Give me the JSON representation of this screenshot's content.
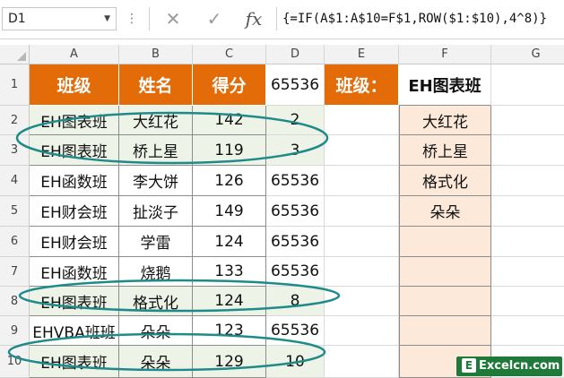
{
  "name_box": "D1",
  "formula": "{=IF(A$1:A$10=F$1,ROW($1:$10),4^8)}",
  "icons": {
    "cancel": "✕",
    "enter": "✓",
    "fx": "fx"
  },
  "columns": [
    "A",
    "B",
    "C",
    "D",
    "E",
    "F",
    "G"
  ],
  "rows": [
    "1",
    "2",
    "3",
    "4",
    "5",
    "6",
    "7",
    "8",
    "9",
    "10"
  ],
  "headers": {
    "class": "班级",
    "name": "姓名",
    "score": "得分"
  },
  "d1_value": "65536",
  "e1_label": "班级：",
  "f1_value": "EH图表班",
  "table": [
    {
      "class": "EH图表班",
      "name": "大红花",
      "score": "142",
      "d": "2"
    },
    {
      "class": "EH图表班",
      "name": "桥上星",
      "score": "119",
      "d": "3"
    },
    {
      "class": "EH函数班",
      "name": "李大饼",
      "score": "126",
      "d": "65536"
    },
    {
      "class": "EH财会班",
      "name": "扯淡子",
      "score": "149",
      "d": "65536"
    },
    {
      "class": "EH财会班",
      "name": "学雷",
      "score": "124",
      "d": "65536"
    },
    {
      "class": "EH函数班",
      "name": "烧鹅",
      "score": "133",
      "d": "65536"
    },
    {
      "class": "EH图表班",
      "name": "格式化",
      "score": "124",
      "d": "8"
    },
    {
      "class": "EHVBA班班",
      "name": "朵朵",
      "score": "123",
      "d": "65536"
    },
    {
      "class": "EH图表班",
      "name": "朵朵",
      "score": "129",
      "d": "10"
    }
  ],
  "result_list": [
    "大红花",
    "桥上星",
    "格式化",
    "朵朵",
    "",
    "",
    "",
    "",
    ""
  ],
  "highlight_rows": [
    2,
    3,
    8,
    10
  ],
  "colors": {
    "header_orange": "#e36c09",
    "highlight_green": "#edf3e6",
    "list_peach": "#fde9d9",
    "ellipse_teal": "#1f8a8a"
  },
  "watermark": "Excelcn.com"
}
